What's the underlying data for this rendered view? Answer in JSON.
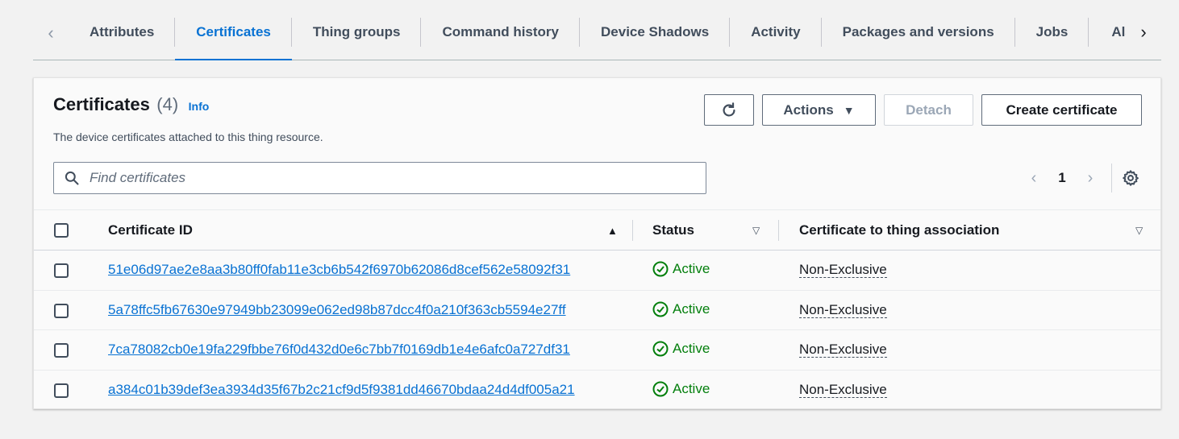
{
  "tabs": [
    {
      "label": "Attributes",
      "active": false
    },
    {
      "label": "Certificates",
      "active": true
    },
    {
      "label": "Thing groups",
      "active": false
    },
    {
      "label": "Command history",
      "active": false
    },
    {
      "label": "Device Shadows",
      "active": false
    },
    {
      "label": "Activity",
      "active": false
    },
    {
      "label": "Packages and versions",
      "active": false
    },
    {
      "label": "Jobs",
      "active": false
    },
    {
      "label": "Ala",
      "active": false
    }
  ],
  "panel": {
    "title": "Certificates",
    "count": "(4)",
    "info_label": "Info",
    "description": "The device certificates attached to this thing resource.",
    "actions_label": "Actions",
    "detach_label": "Detach",
    "create_label": "Create certificate",
    "search_placeholder": "Find certificates",
    "page": "1"
  },
  "table": {
    "columns": {
      "certificate_id": "Certificate ID",
      "status": "Status",
      "association": "Certificate to thing association"
    },
    "rows": [
      {
        "id": "51e06d97ae2e8aa3b80ff0fab11e3cb6b542f6970b62086d8cef562e58092f31",
        "status": "Active",
        "association": "Non-Exclusive"
      },
      {
        "id": "5a78ffc5fb67630e97949bb23099e062ed98b87dcc4f0a210f363cb5594e27ff",
        "status": "Active",
        "association": "Non-Exclusive"
      },
      {
        "id": "7ca78082cb0e19fa229fbbe76f0d432d0e6c7bb7f0169db1e4e6afc0a727df31",
        "status": "Active",
        "association": "Non-Exclusive"
      },
      {
        "id": "a384c01b39def3ea3934d35f67b2c21cf9d5f9381dd46670bdaa24d4df005a21",
        "status": "Active",
        "association": "Non-Exclusive"
      }
    ]
  },
  "colors": {
    "accent": "#0972d3",
    "success": "#037f0c"
  }
}
